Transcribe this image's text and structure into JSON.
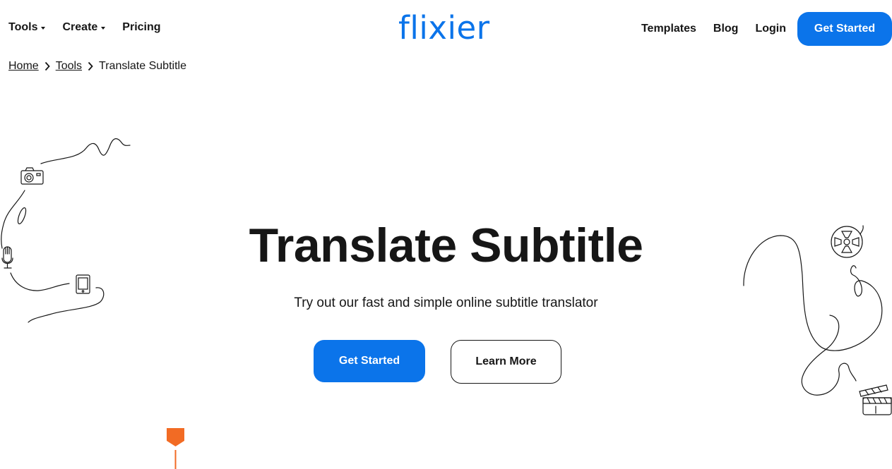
{
  "header": {
    "logo": "flixier",
    "nav_left": [
      {
        "label": "Tools",
        "has_dropdown": true
      },
      {
        "label": "Create",
        "has_dropdown": true
      },
      {
        "label": "Pricing",
        "has_dropdown": false
      }
    ],
    "nav_right": [
      {
        "label": "Templates"
      },
      {
        "label": "Blog"
      },
      {
        "label": "Login"
      }
    ],
    "cta_label": "Get Started"
  },
  "breadcrumb": {
    "items": [
      {
        "label": "Home",
        "link": true
      },
      {
        "label": "Tools",
        "link": true
      },
      {
        "label": "Translate Subtitle",
        "link": false
      }
    ],
    "separator_icon": "chevron-right-icon"
  },
  "hero": {
    "title": "Translate Subtitle",
    "subtitle": "Try out our fast and simple online subtitle translator",
    "primary_button": "Get Started",
    "secondary_button": "Learn More"
  },
  "decorations": {
    "left_icons": [
      "camera-icon",
      "microphone-icon",
      "smartphone-icon"
    ],
    "right_icons": [
      "film-reel-icon",
      "clapperboard-icon"
    ],
    "marker": "orange-pin-marker"
  },
  "colors": {
    "brand_blue": "#0b74ea",
    "text": "#161616",
    "accent_orange": "#f26b24",
    "background": "#ffffff"
  }
}
